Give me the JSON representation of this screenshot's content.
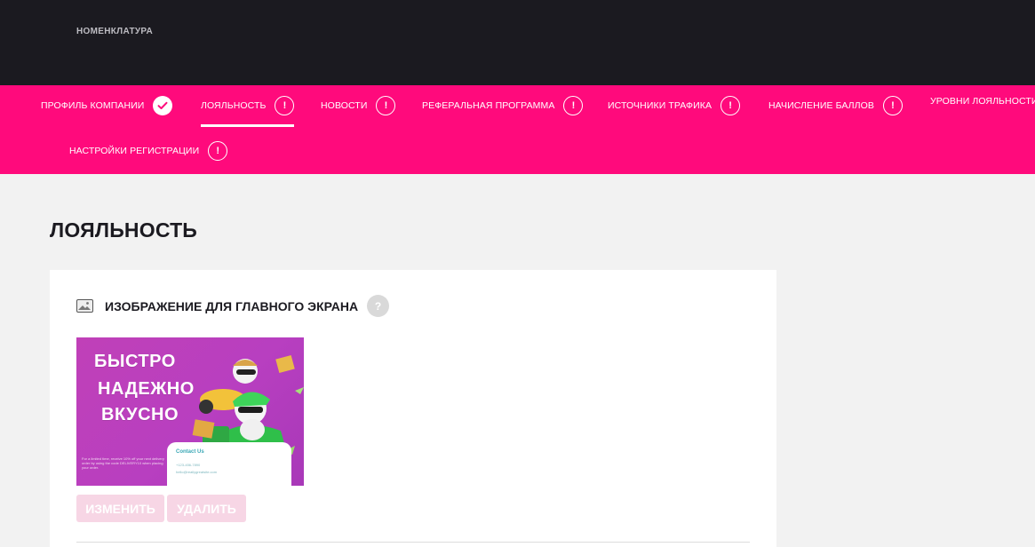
{
  "top_header": {
    "partial_text": "",
    "nav_link": "НОМЕНКЛАТУРА"
  },
  "tabs": [
    {
      "label": "ПРОФИЛЬ КОМПАНИИ",
      "status": "done"
    },
    {
      "label": "ЛОЯЛЬНОСТЬ",
      "status": "warning",
      "active": true
    },
    {
      "label": "НОВОСТИ",
      "status": "warning"
    },
    {
      "label": "РЕФЕРАЛЬНАЯ ПРОГРАММА",
      "status": "warning"
    },
    {
      "label": "ИСТОЧНИКИ ТРАФИКА",
      "status": "warning"
    },
    {
      "label": "НАЧИСЛЕНИЕ БАЛЛОВ",
      "status": "warning"
    },
    {
      "label": "УРОВНИ ЛОЯЛЬНОСТИ",
      "status": "warning"
    },
    {
      "label": "НАСТРОЙКИ РЕГИСТРАЦИИ",
      "status": "warning"
    }
  ],
  "page": {
    "title": "ЛОЯЛЬНОСТЬ"
  },
  "section": {
    "title": "ИЗОБРАЖЕНИЕ ДЛЯ ГЛАВНОГО ЭКРАНА",
    "help_symbol": "?"
  },
  "banner": {
    "line1": "БЫСТРО",
    "line2": "НАДЕЖНО",
    "line3": "ВКУСНО",
    "fine_print": "For a limited time, receive 10% off your next delivery order by using the code DELIVERY10 when placing your order.",
    "contact_title": "Contact Us",
    "contact_phone": "+123-456-7890",
    "contact_email": "hello@reallygreatsite.com"
  },
  "buttons": {
    "change_label": "ИЗМЕНИТЬ",
    "delete_label": "УДАЛИТЬ"
  },
  "badge_symbol": "!",
  "colors": {
    "header_bg": "#1b1a20",
    "accent": "#ff0a7c",
    "page_bg": "#f2f2f2",
    "disabled_button": "#f7d6e5"
  }
}
